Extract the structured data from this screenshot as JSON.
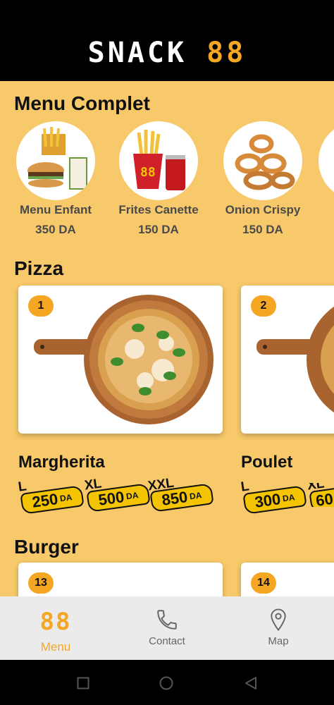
{
  "header": {
    "logo_text": "SNACK",
    "logo_number": "88"
  },
  "sections": {
    "menu_complet": {
      "title": "Menu Complet",
      "items": [
        {
          "name": "Menu Enfant",
          "price": "350 DA"
        },
        {
          "name": "Frites Canette",
          "price": "150 DA"
        },
        {
          "name": "Onion Crispy",
          "price": "150 DA"
        }
      ]
    },
    "pizza": {
      "title": "Pizza",
      "items": [
        {
          "number": "1",
          "name": "Margherita",
          "sizes": [
            {
              "size": "L",
              "price": "250",
              "currency": "DA"
            },
            {
              "size": "XL",
              "price": "500",
              "currency": "DA"
            },
            {
              "size": "XXL",
              "price": "850",
              "currency": "DA"
            }
          ]
        },
        {
          "number": "2",
          "name": "Poulet",
          "sizes": [
            {
              "size": "L",
              "price": "300",
              "currency": "DA"
            },
            {
              "size": "XL",
              "price": "60",
              "currency": ""
            }
          ]
        }
      ]
    },
    "burger": {
      "title": "Burger",
      "items": [
        {
          "number": "13"
        },
        {
          "number": "14"
        }
      ]
    }
  },
  "bottom_nav": {
    "items": [
      {
        "label": "Menu",
        "icon": "logo-88-icon",
        "active": true
      },
      {
        "label": "Contact",
        "icon": "phone-icon",
        "active": false
      },
      {
        "label": "Map",
        "icon": "map-pin-icon",
        "active": false
      }
    ],
    "menu_icon_text": "88"
  },
  "colors": {
    "accent": "#f5a623",
    "background": "#f8c96a",
    "header": "#000000",
    "nav_bg": "#ebebeb",
    "inactive": "#666666"
  }
}
